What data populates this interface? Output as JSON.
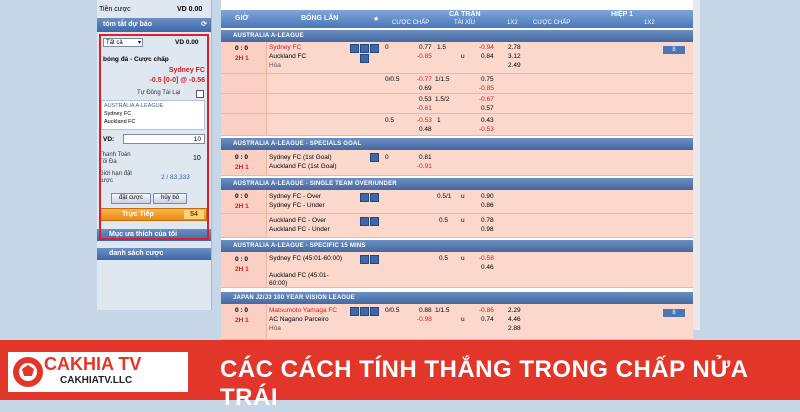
{
  "sidebar": {
    "tien_cuoc_label": "Tiền cược",
    "tien_cuoc_value": "VD 0.00",
    "summary_title": "tóm tắt dự báo",
    "select_value": "Tất cả",
    "vd_value": "VD 0.00",
    "bet_type": "bóng đá - Cược chấp",
    "team": "Sydney FC",
    "odds_line": "-0.5 [0-0] @ -0.56",
    "auto_accept": "Tự Đồng Tài Lại",
    "match_league": "AUSTRALIA A-LEAGUE",
    "match_home": "Sydney FC",
    "match_away": "Auckland FC",
    "vd_label": "VD:",
    "vd_input": "10",
    "max_pay_label": "Thanh Toán Tối Đa",
    "max_pay_value": "10",
    "limit_label": "Giới hạn đặt cược",
    "limit_value": "2 / 83,333",
    "bet_button": "đặt cược",
    "cancel_button": "hủy bỏ",
    "live_label": "Trực Tiếp",
    "live_count": "54",
    "fav_label": "Mục ưa thích của tôi",
    "bet_list_label": "danh sách cược"
  },
  "table": {
    "col_time": "GIỜ",
    "col_match": "BÓNG LĂN",
    "full_time": "CẢ TRẬN",
    "half": "HIỆP 1",
    "handicap": "CƯỢC CHẤP",
    "over_under": "TÀI XỈU",
    "x12": "1X2",
    "handicap_h1": "CƯỢC CHẤP",
    "x12_h1": "1X2"
  },
  "leagues": [
    {
      "name": "AUSTRALIA A-LEAGUE"
    },
    {
      "name": "AUSTRALIA A-LEAGUE - SPECIALS GOAL"
    },
    {
      "name": "AUSTRALIA A-LEAGUE - SINGLE TEAM OVER/UNDER"
    },
    {
      "name": "AUSTRALIA A-LEAGUE - SPECIFIC 15 MINS"
    },
    {
      "name": "JAPAN J2/J3 100 YEAR VISION LEAGUE"
    }
  ],
  "match1": {
    "score": "0 : 0",
    "period": "2H 1",
    "home": "Sydney FC",
    "away": "Auckland FC",
    "draw": "Hòa",
    "hcap": "0",
    "h1": "0.77",
    "a1": "-0.85",
    "ou": "1.5",
    "ou_u": "u",
    "o1": "-0.94",
    "u1": "0.84",
    "x1": "2.78",
    "x2": "3.12",
    "x3": "2.49",
    "more": "8",
    "rows": [
      {
        "h": "0/0.5",
        "hv": "-0.77",
        "av": "0.69",
        "ou": "1/1.5",
        "ov": "0.75",
        "uv": "-0.85"
      },
      {
        "h": "",
        "hv": "0.53",
        "av": "-0.61",
        "ou": "1.5/2",
        "ov": "-0.67",
        "uv": "0.57"
      },
      {
        "h": "0.5",
        "hv": "-0.53",
        "av": "0.48",
        "ou": "1",
        "ov": "0.43",
        "uv": "-0.53"
      }
    ]
  },
  "match2": {
    "score": "0 : 0",
    "period": "2H 1",
    "home": "Sydney FC (1st Goal)",
    "away": "Auckland FC (1st Goal)",
    "hcap": "0",
    "hv": "0.81",
    "av": "-0.91"
  },
  "match3": {
    "score": "0 : 0",
    "period": "2H 1",
    "home": "Sydney FC - Over",
    "away": "Sydney FC - Under",
    "ou": "0.5/1",
    "u": "u",
    "ov": "0.90",
    "uv": "0.86"
  },
  "match3b": {
    "home": "Auckland FC - Over",
    "away": "Auckland FC - Under",
    "ou": "0.5",
    "u": "u",
    "ov": "0.78",
    "uv": "0.98"
  },
  "match4": {
    "score": "0 : 0",
    "period": "2H 1",
    "home": "Sydney FC (45:01-60:00)",
    "away": "Auckland FC (45:01-60:00)",
    "ou": "0.5",
    "u": "u",
    "ov": "-0.58",
    "uv": "0.46"
  },
  "match5": {
    "score": "0 : 0",
    "period": "2H 1",
    "home": "Matsumoto Yamaga FC",
    "away": "AC Nagano Parceiro",
    "draw": "Hòa",
    "h": "0/0.5",
    "hv": "0.88",
    "av": "-0.98",
    "ou": "1/1.5",
    "u": "u",
    "ov": "-0.86",
    "uv": "0.74",
    "x1": "2.29",
    "x2": "4.46",
    "x3": "2.88",
    "more": "8"
  },
  "banner": {
    "title": "CÁC CÁCH TÍNH THẮNG TRONG CHẤP NỬA TRÁI",
    "brand": "CAKHIA TV",
    "site": "CAKHIATV.LLC",
    "color": "#e3362b"
  }
}
